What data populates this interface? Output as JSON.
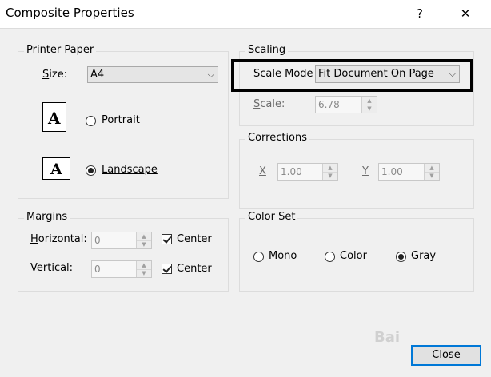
{
  "window": {
    "title": "Composite Properties",
    "help_glyph": "?",
    "close_glyph": "✕"
  },
  "printer_paper": {
    "legend": "Printer Paper",
    "size_label": "Size:",
    "size_value": "A4",
    "portrait_label": "Portrait",
    "landscape_label": "Landscape",
    "orientation_selected": "Landscape",
    "icon_letter": "A"
  },
  "scaling": {
    "legend": "Scaling",
    "mode_label": "Scale Mode",
    "mode_value": "Fit Document On Page",
    "scale_label": "Scale:",
    "scale_value": "6.78"
  },
  "corrections": {
    "legend": "Corrections",
    "x_label": "X",
    "x_value": "1.00",
    "y_label": "Y",
    "y_value": "1.00"
  },
  "margins": {
    "legend": "Margins",
    "horizontal_label": "Horizontal:",
    "horizontal_value": "0",
    "vertical_label": "Vertical:",
    "vertical_value": "0",
    "center_label": "Center",
    "center_h_checked": true,
    "center_v_checked": true
  },
  "color_set": {
    "legend": "Color Set",
    "mono_label": "Mono",
    "color_label": "Color",
    "gray_label": "Gray",
    "selected": "Gray"
  },
  "footer": {
    "close_label": "Close",
    "watermark": "Bai"
  },
  "icons": {
    "arrow_down": "⌵",
    "spin_up": "▲",
    "spin_down": "▼"
  }
}
